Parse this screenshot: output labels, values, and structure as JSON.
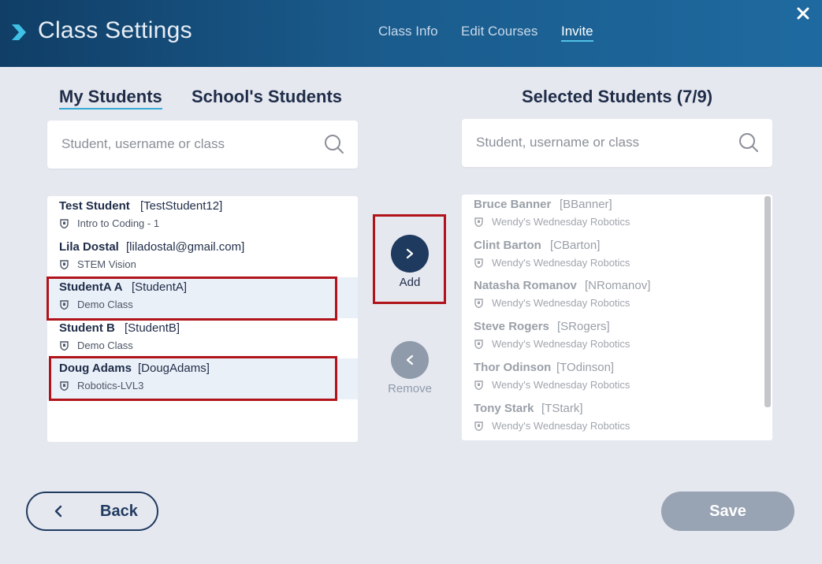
{
  "header": {
    "title": "Class Settings",
    "tabs": [
      {
        "label": "Class Info"
      },
      {
        "label": "Edit Courses"
      },
      {
        "label": "Invite"
      }
    ],
    "close_icon": "close-icon"
  },
  "left": {
    "tabs": [
      {
        "label": "My Students"
      },
      {
        "label": "School's Students"
      }
    ],
    "search_placeholder": "Student, username or class",
    "students": [
      {
        "name": "Test Student",
        "username": "[TestStudent12]",
        "class": "Intro to Coding - 1"
      },
      {
        "name": "Lila Dostal",
        "username": "[liladostal@gmail.com]",
        "class": "STEM Vision"
      },
      {
        "name": "StudentA A",
        "username": "[StudentA]",
        "class": "Demo Class"
      },
      {
        "name": "Student B",
        "username": "[StudentB]",
        "class": "Demo Class"
      },
      {
        "name": "Doug Adams",
        "username": "[DougAdams]",
        "class": "Robotics-LVL3"
      }
    ]
  },
  "right": {
    "title": "Selected Students (7/9)",
    "search_placeholder": "Student, username or class",
    "students": [
      {
        "name": "Bruce Banner",
        "username": "[BBanner]",
        "class": "Wendy's Wednesday Robotics"
      },
      {
        "name": "Clint Barton",
        "username": "[CBarton]",
        "class": "Wendy's Wednesday Robotics"
      },
      {
        "name": "Natasha Romanov",
        "username": "[NRomanov]",
        "class": "Wendy's Wednesday Robotics"
      },
      {
        "name": "Steve Rogers",
        "username": "[SRogers]",
        "class": "Wendy's Wednesday Robotics"
      },
      {
        "name": "Thor Odinson",
        "username": "[TOdinson]",
        "class": "Wendy's Wednesday Robotics"
      },
      {
        "name": "Tony Stark",
        "username": "[TStark]",
        "class": "Wendy's Wednesday Robotics"
      }
    ]
  },
  "actions": {
    "add_label": "Add",
    "remove_label": "Remove",
    "back_label": "Back",
    "save_label": "Save"
  },
  "colors": {
    "header_start": "#103e66",
    "header_end": "#1e6aa0",
    "accent_underline": "#36a9d6",
    "navy": "#1f3a5f",
    "highlight_box": "#b0141a",
    "disabled": "#98a3b3"
  }
}
